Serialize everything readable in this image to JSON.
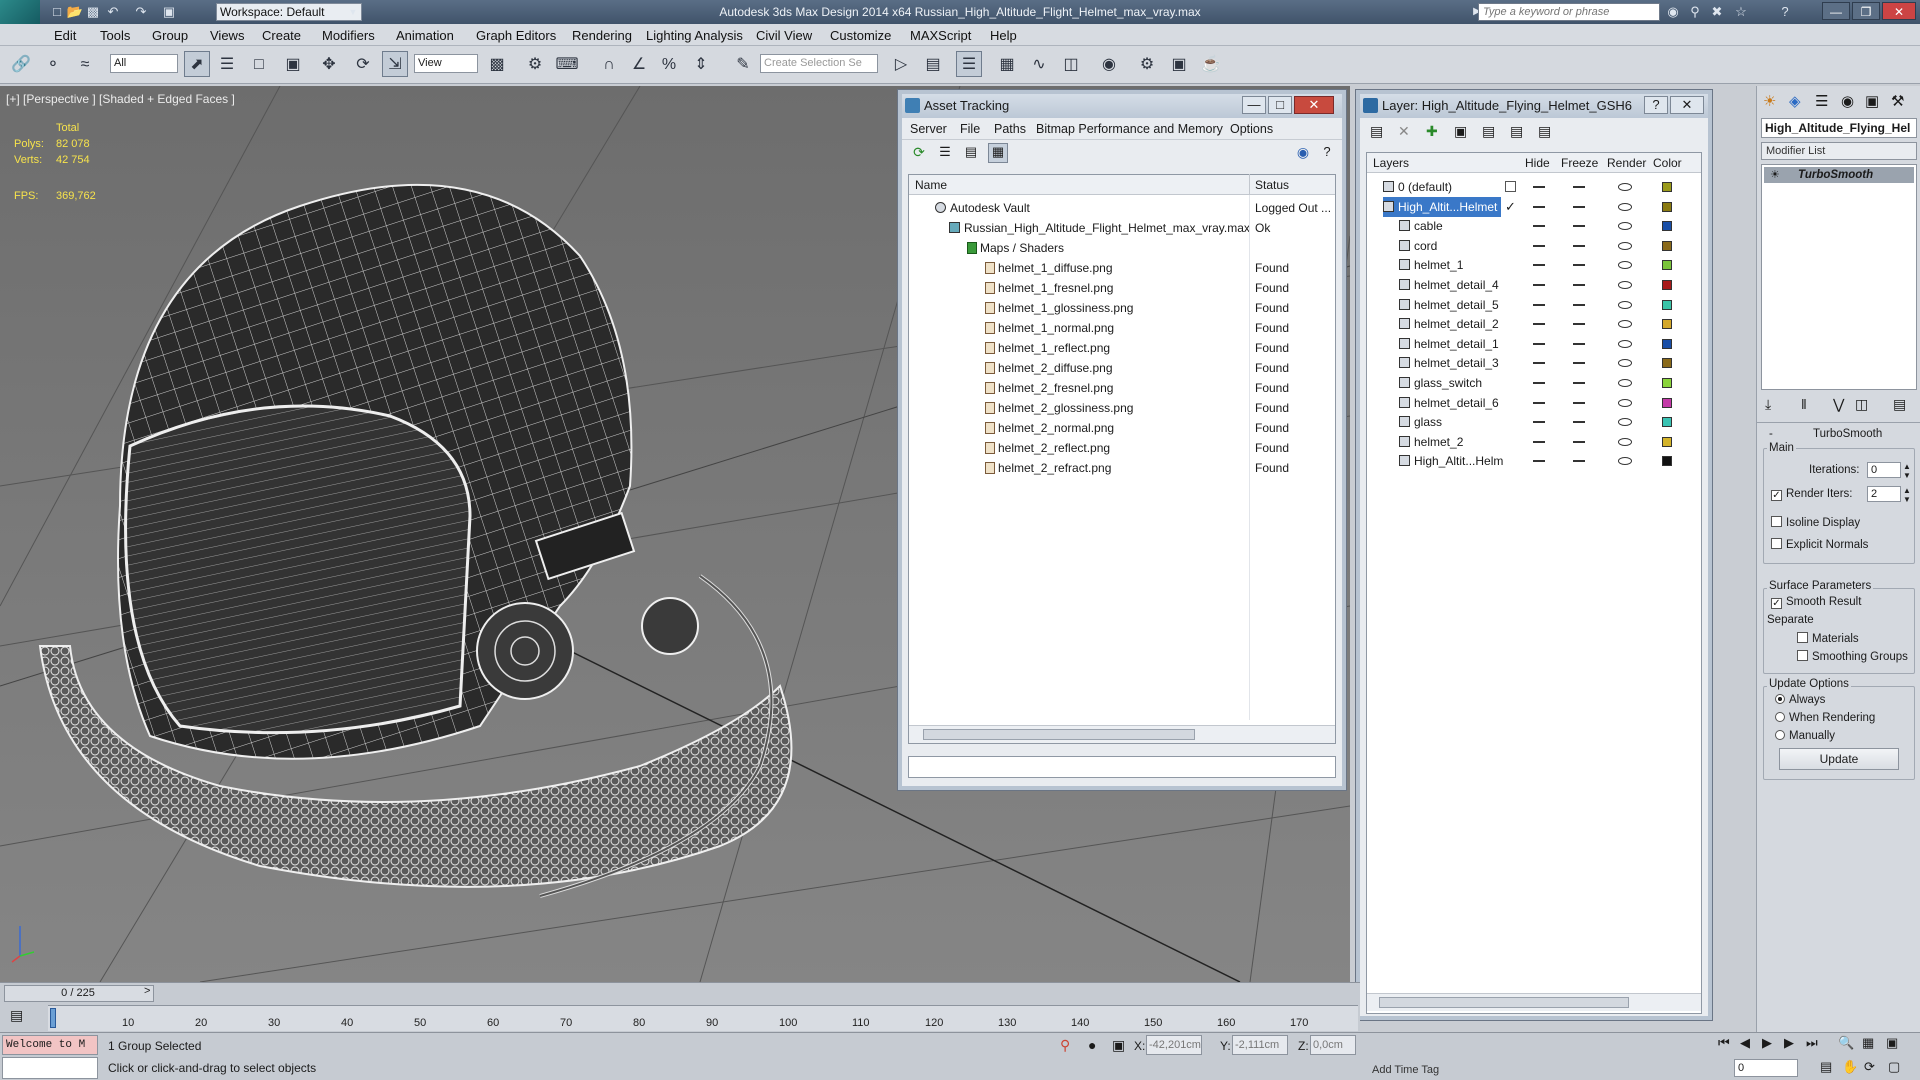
{
  "app": {
    "title": "Autodesk 3ds Max Design 2014 x64     Russian_High_Altitude_Flight_Helmet_max_vray.max",
    "logo": "MXD",
    "workspace": "Workspace: Default",
    "search_placeholder": "Type a keyword or phrase"
  },
  "menu": [
    "Edit",
    "Tools",
    "Group",
    "Views",
    "Create",
    "Modifiers",
    "Animation",
    "Graph Editors",
    "Rendering",
    "Lighting Analysis",
    "Civil View",
    "Customize",
    "MAXScript",
    "Help"
  ],
  "toolbar": {
    "selection_filter": "All",
    "reference_coord": "View",
    "named_selection_placeholder": "Create Selection Se"
  },
  "viewport": {
    "label": "[+] [Perspective ] [Shaded + Edged Faces ]",
    "stats_total": "Total",
    "polys_label": "Polys:",
    "polys_value": "82 078",
    "verts_label": "Verts:",
    "verts_value": "42 754",
    "fps_label": "FPS:",
    "fps_value": "369,762"
  },
  "asset_tracking": {
    "title": "Asset Tracking",
    "menu": [
      "Server",
      "File",
      "Paths",
      "Bitmap Performance and Memory",
      "Options"
    ],
    "col_name": "Name",
    "col_status": "Status",
    "rows": [
      {
        "name": "Autodesk Vault",
        "status": "Logged Out ..."
      },
      {
        "name": "Russian_High_Altitude_Flight_Helmet_max_vray.max",
        "status": "Ok"
      },
      {
        "name": "Maps / Shaders",
        "status": ""
      },
      {
        "name": "helmet_1_diffuse.png",
        "status": "Found"
      },
      {
        "name": "helmet_1_fresnel.png",
        "status": "Found"
      },
      {
        "name": "helmet_1_glossiness.png",
        "status": "Found"
      },
      {
        "name": "helmet_1_normal.png",
        "status": "Found"
      },
      {
        "name": "helmet_1_reflect.png",
        "status": "Found"
      },
      {
        "name": "helmet_2_diffuse.png",
        "status": "Found"
      },
      {
        "name": "helmet_2_fresnel.png",
        "status": "Found"
      },
      {
        "name": "helmet_2_glossiness.png",
        "status": "Found"
      },
      {
        "name": "helmet_2_normal.png",
        "status": "Found"
      },
      {
        "name": "helmet_2_reflect.png",
        "status": "Found"
      },
      {
        "name": "helmet_2_refract.png",
        "status": "Found"
      }
    ]
  },
  "layer_manager": {
    "title": "Layer: High_Altitude_Flying_Helmet_GSH6",
    "help": "?",
    "col_layers": "Layers",
    "col_hide": "Hide",
    "col_freeze": "Freeze",
    "col_render": "Render",
    "col_color": "Color",
    "layers": [
      {
        "name": "0 (default)",
        "color": "#9a9a1a"
      },
      {
        "name": "High_Altit...Helmet",
        "color": "#8a7a10"
      },
      {
        "name": "cable",
        "color": "#1a4fa8"
      },
      {
        "name": "cord",
        "color": "#8a6a1a"
      },
      {
        "name": "helmet_1",
        "color": "#7ac43a"
      },
      {
        "name": "helmet_detail_4",
        "color": "#a81a1a"
      },
      {
        "name": "helmet_detail_5",
        "color": "#3ac4a8"
      },
      {
        "name": "helmet_detail_2",
        "color": "#d4a82a"
      },
      {
        "name": "helmet_detail_1",
        "color": "#1a4fa8"
      },
      {
        "name": "helmet_detail_3",
        "color": "#8a6a1a"
      },
      {
        "name": "glass_switch",
        "color": "#8ad43a"
      },
      {
        "name": "helmet_detail_6",
        "color": "#c43aa8"
      },
      {
        "name": "glass",
        "color": "#3ac4b4"
      },
      {
        "name": "helmet_2",
        "color": "#d4b42a"
      },
      {
        "name": "High_Altit...Helm",
        "color": "#111111"
      }
    ]
  },
  "command_panel": {
    "object_name": "High_Altitude_Flying_Hel",
    "modifier_list": "Modifier List",
    "stack_item": "TurboSmooth",
    "rollout_title": "TurboSmooth",
    "main_label": "Main",
    "iterations_label": "Iterations:",
    "iterations_value": "0",
    "render_iters_label": "Render Iters:",
    "render_iters_value": "2",
    "isoline": "Isoline Display",
    "explicit_normals": "Explicit Normals",
    "surface_params": "Surface Parameters",
    "smooth_result": "Smooth Result",
    "separate": "Separate",
    "materials": "Materials",
    "smoothing_groups": "Smoothing Groups",
    "update_options": "Update Options",
    "always": "Always",
    "when_rendering": "When Rendering",
    "manually": "Manually",
    "update_btn": "Update"
  },
  "timeline": {
    "frame": "0 / 225",
    "ticks": [
      "10",
      "20",
      "30",
      "40",
      "50",
      "60",
      "70",
      "80",
      "90",
      "100",
      "110",
      "120",
      "130",
      "140",
      "150",
      "160",
      "170"
    ]
  },
  "status": {
    "listener": "Welcome to M",
    "selected": "1 Group Selected",
    "prompt": "Click or click-and-drag to select objects",
    "x_label": "X:",
    "x_value": "-42,201cm",
    "y_label": "Y:",
    "y_value": "-2,111cm",
    "z_label": "Z:",
    "z_value": "0,0cm",
    "add_time_tag": "Add Time Tag",
    "frame_field": "0"
  }
}
